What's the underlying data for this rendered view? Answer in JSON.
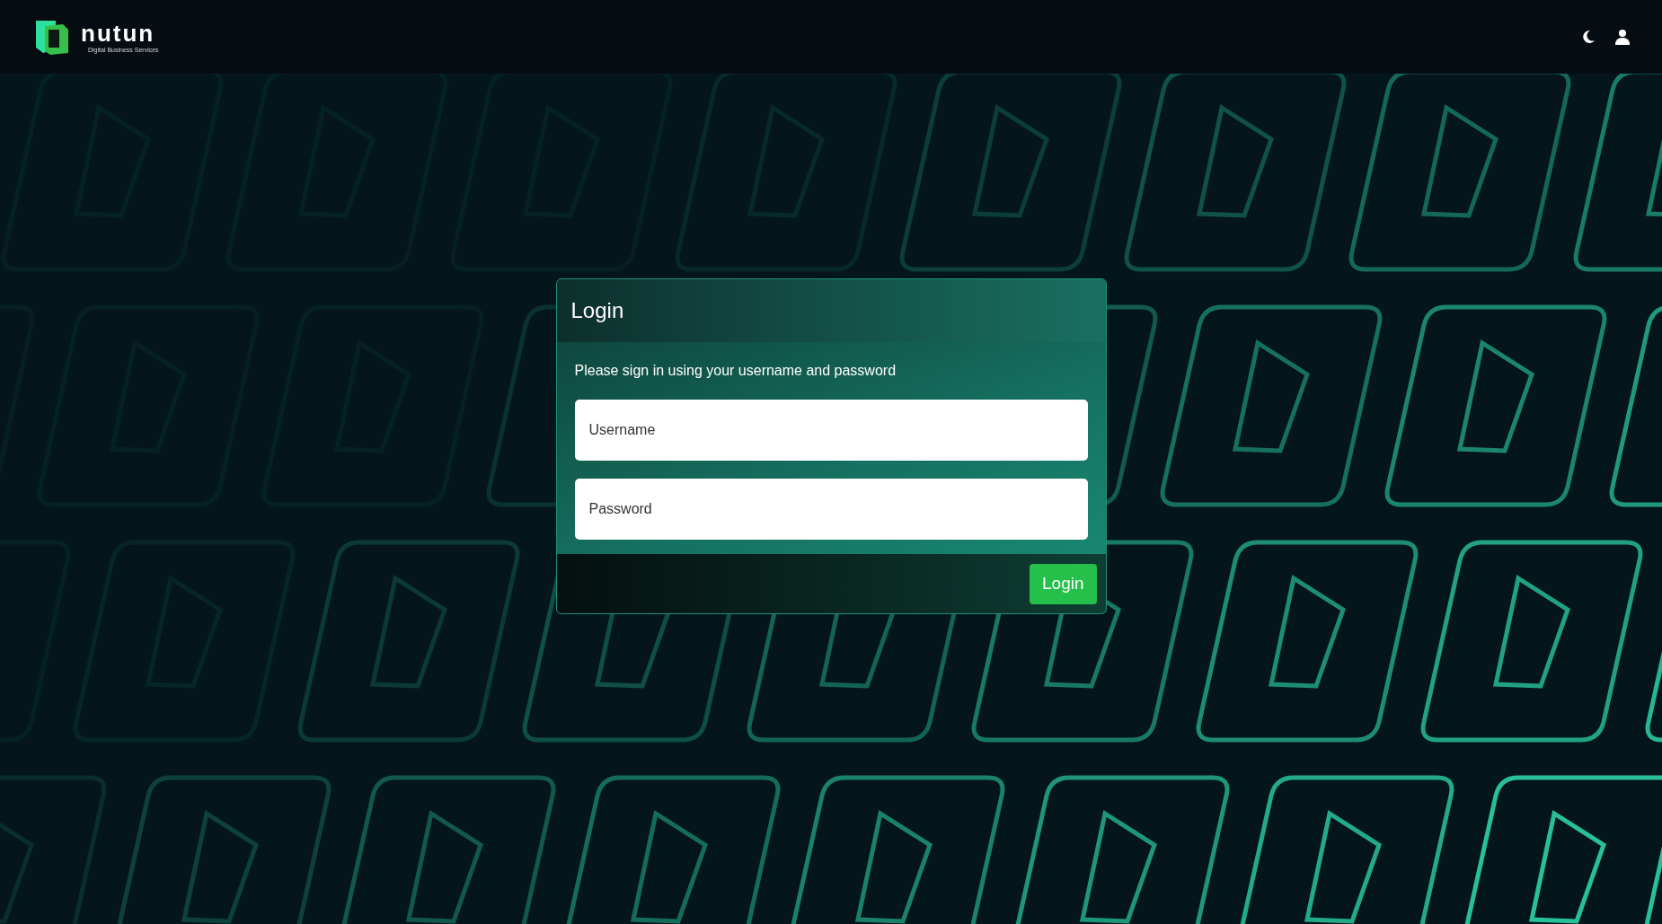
{
  "header": {
    "brand": {
      "name": "nutun",
      "tagline": "Digital Business Services"
    }
  },
  "login": {
    "title": "Login",
    "instruction": "Please sign in using your username and password",
    "fields": [
      {
        "placeholder": "Username"
      },
      {
        "placeholder": "Password"
      }
    ],
    "button": "Login"
  }
}
